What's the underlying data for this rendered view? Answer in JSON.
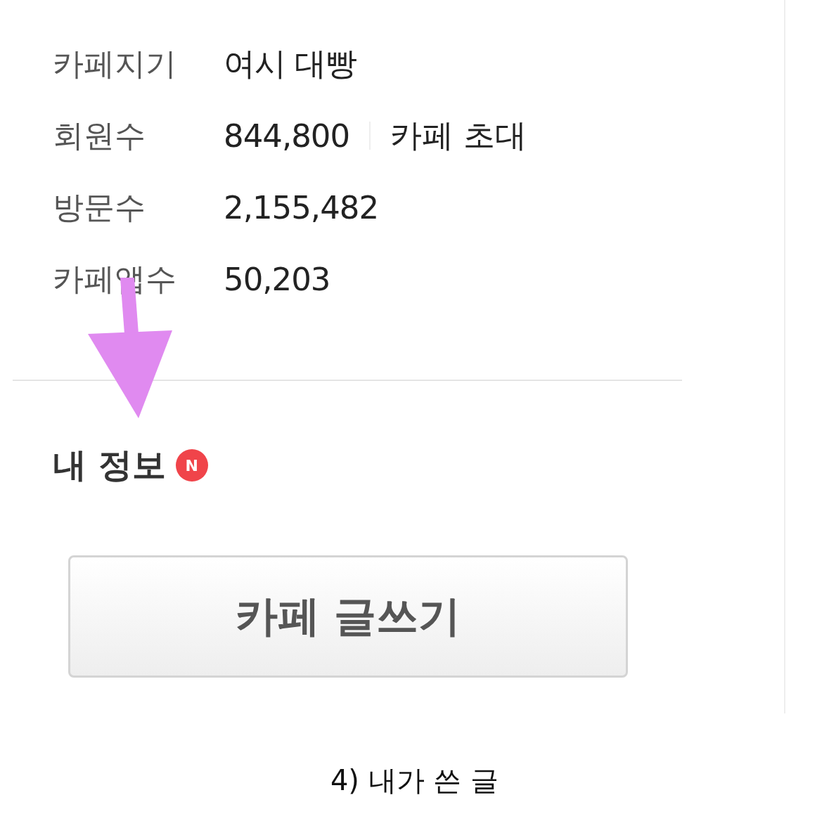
{
  "cafe_info": [
    {
      "label": "카페지기",
      "value": "여시 대빵"
    },
    {
      "label": "회원수",
      "value": "844,800",
      "link": "카페 초대"
    },
    {
      "label": "방문수",
      "value": "2,155,482"
    },
    {
      "label": "카페앱수",
      "value": "50,203"
    }
  ],
  "my_info": {
    "title": "내 정보",
    "badge": "N"
  },
  "write_button": "카페 글쓰기",
  "caption": "4) 내가 쓴 글"
}
